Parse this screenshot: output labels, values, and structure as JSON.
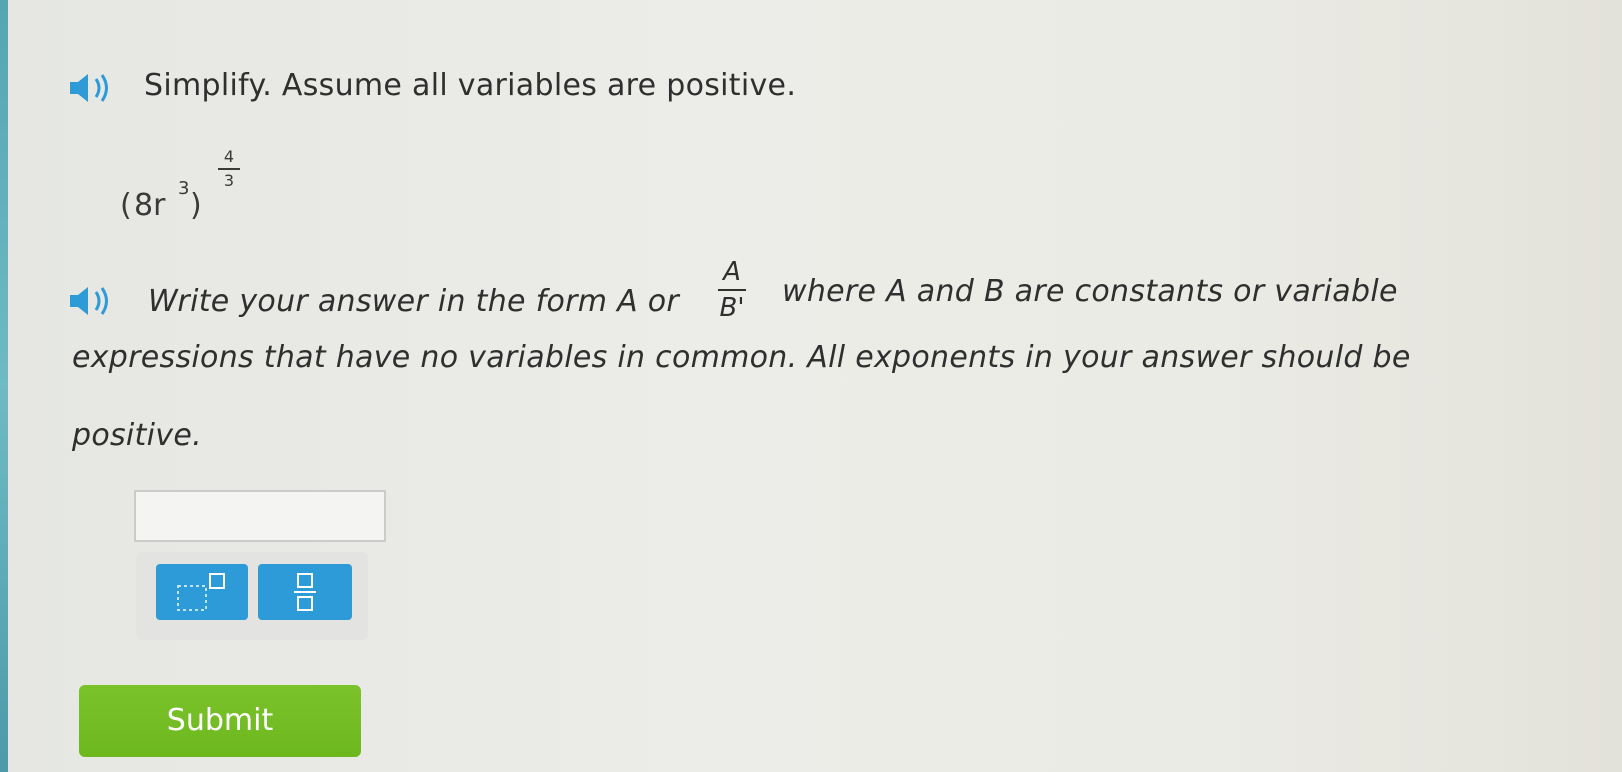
{
  "question": {
    "line1": "Simplify. Assume all variables are positive.",
    "expression": {
      "open_paren": "(",
      "base": "8r",
      "inner_exponent": "3",
      "close_paren": ")",
      "outer_exponent_numerator": "4",
      "outer_exponent_denominator": "3"
    },
    "instruction": {
      "part1": "Write your answer in the form A or",
      "fraction_numerator": "A",
      "fraction_denominator": "B'",
      "part2": "where A and B are constants or variable",
      "line2": "expressions that have no variables in common. All exponents in your answer should be",
      "line3": "positive."
    }
  },
  "answer": {
    "value": ""
  },
  "tools": [
    {
      "icon": "exponent-template-icon"
    },
    {
      "icon": "fraction-template-icon"
    }
  ],
  "submit_label": "Submit",
  "colors": {
    "tool_button": "#2e9bd9",
    "submit_button": "#72bb22",
    "audio_icon": "#2e9bd9"
  }
}
